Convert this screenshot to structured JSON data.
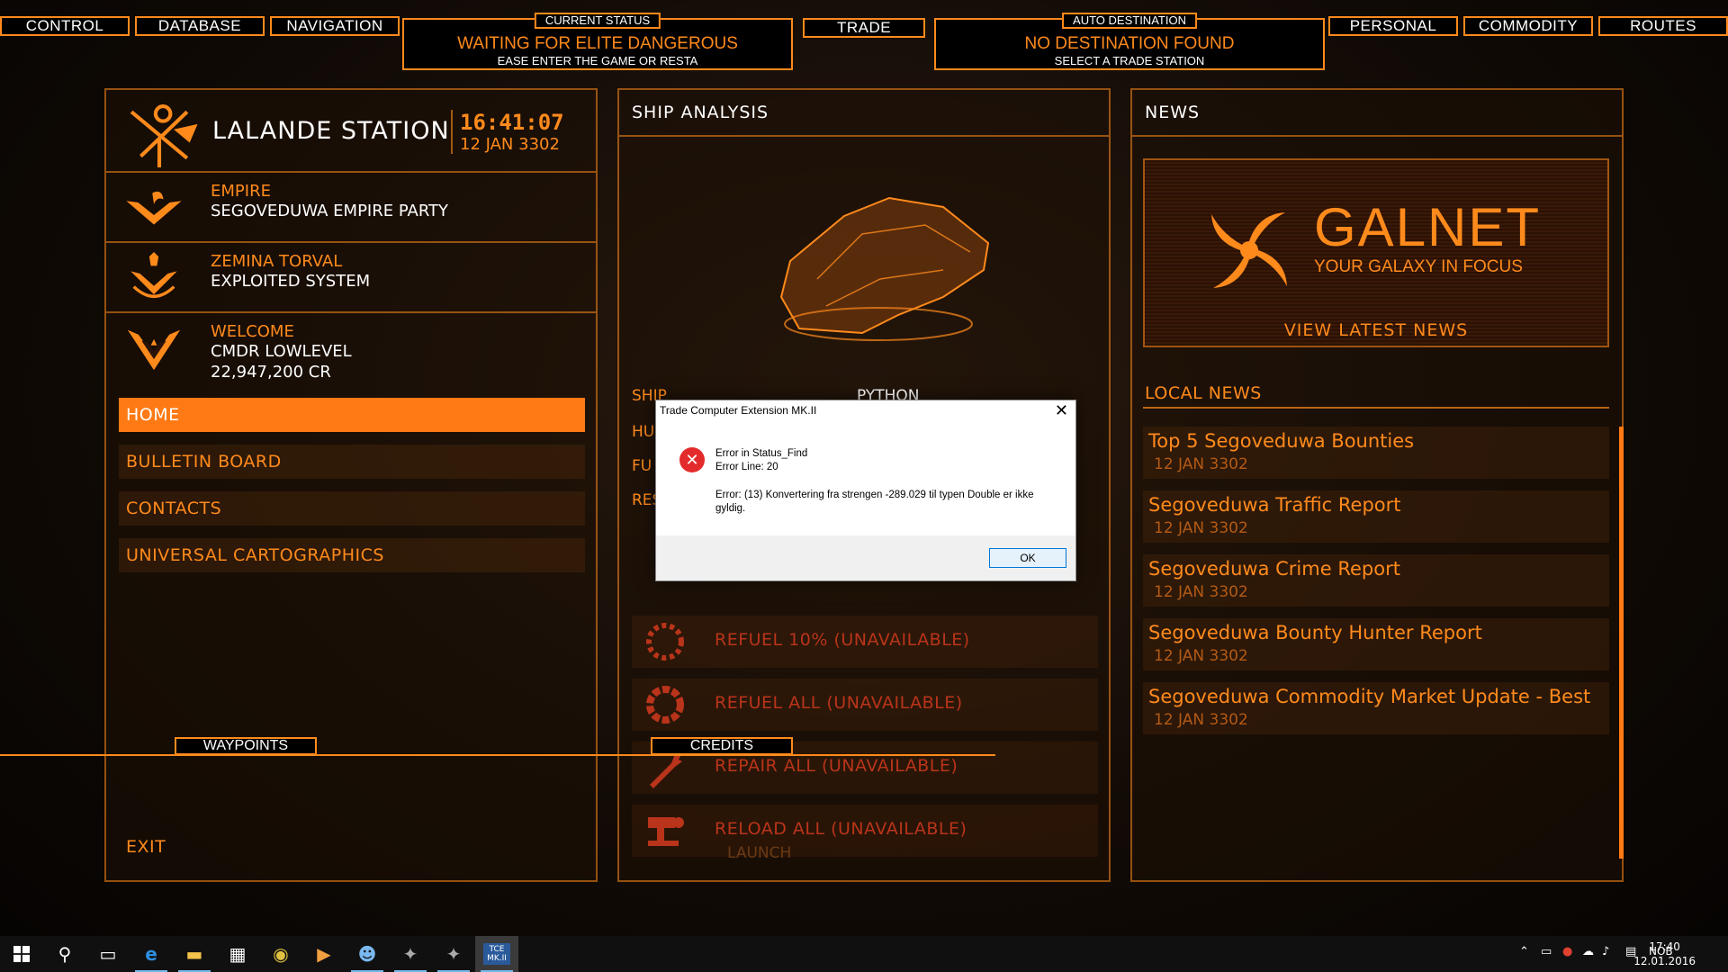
{
  "top_nav": {
    "control": "CONTROL",
    "database": "DATABASE",
    "navigation": "NAVIGATION",
    "trade": "TRADE",
    "personal": "PERSONAL",
    "commodity": "COMMODITY",
    "routes": "ROUTES"
  },
  "current_status": {
    "label": "CURRENT STATUS",
    "main": "WAITING FOR ELITE DANGEROUS",
    "sub": "EASE ENTER THE GAME OR RESTA"
  },
  "auto_destination": {
    "label": "AUTO DESTINATION",
    "main": "NO DESTINATION FOUND",
    "sub": "SELECT A TRADE STATION"
  },
  "station": {
    "name": "LALANDE STATION",
    "time": "16:41:07",
    "date": "12 JAN 3302",
    "rows": [
      {
        "key": "EMPIRE",
        "value": "SEGOVEDUWA EMPIRE PARTY",
        "value2": ""
      },
      {
        "key": "ZEMINA TORVAL",
        "value": "EXPLOITED SYSTEM",
        "value2": ""
      },
      {
        "key": "WELCOME",
        "value": "CMDR LOWLEVEL",
        "value2": "22,947,200 CR"
      }
    ]
  },
  "menu": [
    {
      "label": "HOME"
    },
    {
      "label": "BULLETIN BOARD"
    },
    {
      "label": "CONTACTS"
    },
    {
      "label": "UNIVERSAL CARTOGRAPHICS"
    }
  ],
  "exit_label": "EXIT",
  "ship": {
    "title": "SHIP ANALYSIS",
    "ship_label": "SHIP",
    "ship_value": "PYTHON",
    "partial_rows": [
      "HU",
      "FU",
      "RES"
    ],
    "actions": [
      {
        "label": "REFUEL  10% (UNAVAILABLE)"
      },
      {
        "label": "REFUEL ALL (UNAVAILABLE)"
      },
      {
        "label": "REPAIR ALL (UNAVAILABLE)"
      },
      {
        "label": "RELOAD ALL (UNAVAILABLE)"
      }
    ],
    "launch": "LAUNCH"
  },
  "news": {
    "title": "NEWS",
    "galnet_word": "GALNET",
    "galnet_tag": "YOUR GALAXY IN FOCUS",
    "galnet_link": "VIEW LATEST NEWS",
    "local_title": "LOCAL NEWS",
    "items": [
      {
        "headline": "Top 5 Segoveduwa Bounties",
        "date": "12 JAN 3302"
      },
      {
        "headline": "Segoveduwa Traffic Report",
        "date": "12 JAN 3302"
      },
      {
        "headline": "Segoveduwa Crime Report",
        "date": "12 JAN 3302"
      },
      {
        "headline": "Segoveduwa Bounty Hunter Report",
        "date": "12 JAN 3302"
      },
      {
        "headline": "Segoveduwa Commodity Market Update - Best",
        "date": "12 JAN 3302"
      }
    ]
  },
  "bottom": {
    "waypoints": "WAYPOINTS",
    "credits": "CREDITS"
  },
  "dialog": {
    "title": "Trade Computer Extension MK.II",
    "line1": "Error in Status_Find",
    "line2": "Error Line: 20",
    "line3": "Error: (13) Konvertering fra strengen -289.029 til typen Double er ikke gyldig.",
    "ok": "OK"
  },
  "taskbar": {
    "lang": "NOB",
    "time": "17:40",
    "date": "12.01.2016",
    "tce_label": "TCE MK.II"
  },
  "colors": {
    "accent": "#ff8a1c",
    "active_menu": "#ff7a14",
    "unavailable": "#b9341a"
  }
}
